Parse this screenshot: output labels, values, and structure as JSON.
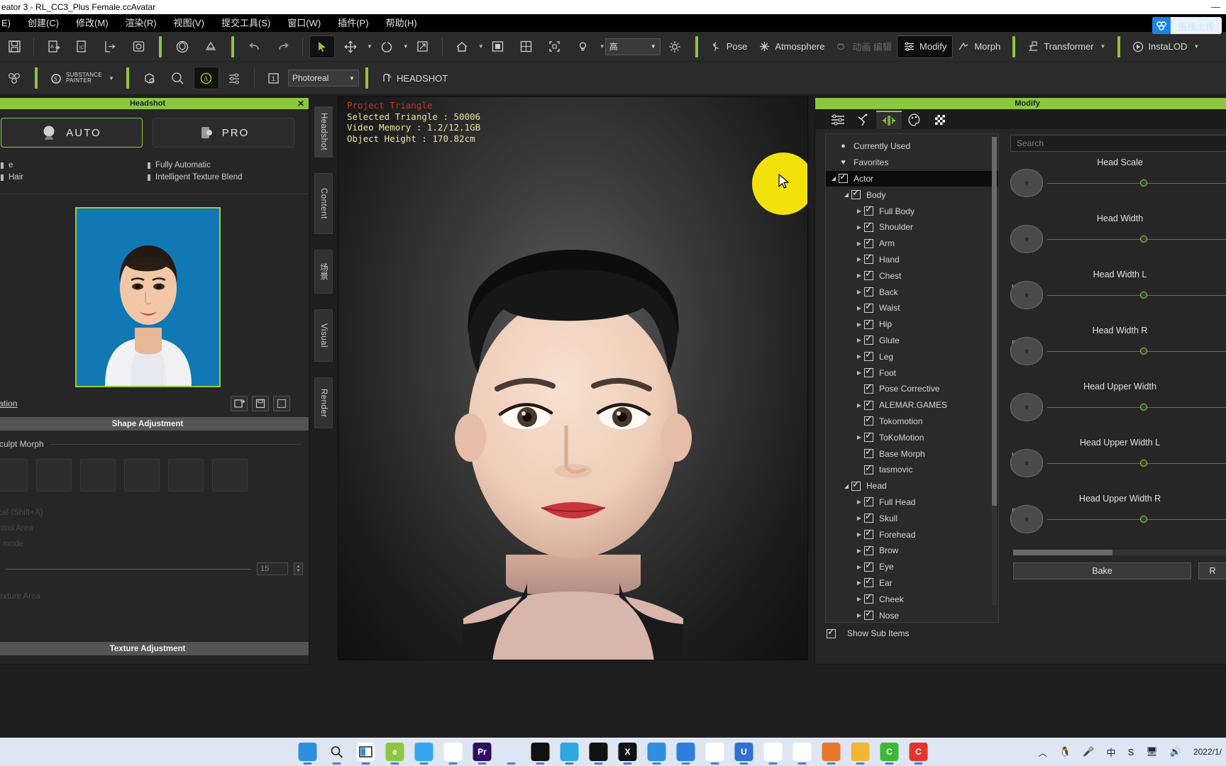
{
  "window": {
    "title": "eator 3 - RL_CC3_Plus Female.ccAvatar",
    "minimize": "—"
  },
  "menu": {
    "items": [
      "E)",
      "创建(C)",
      "修改(M)",
      "渲染(R)",
      "视图(V)",
      "提交工具(S)",
      "窗口(W)",
      "插件(P)",
      "帮助(H)"
    ]
  },
  "toolbar_top": {
    "icons": [
      "save-icon",
      "save-as-icon",
      "import-icon",
      "export-icon",
      "preview-icon",
      "object-icon",
      "terrain-icon"
    ],
    "undo": "undo-icon",
    "redo": "redo-icon",
    "select": "select-arrow-icon",
    "move": "move-icon",
    "rotate": "rotate-icon",
    "scale": "scale-icon",
    "home": "home-icon",
    "camera": "camera-icon",
    "grid": "grid-icon",
    "frame": "frame-icon",
    "light": "light-bulb-icon",
    "quality_value": "高",
    "sun": "sun-icon",
    "pose": "Pose",
    "atmosphere": "Atmosphere",
    "dim_label": "动画 编辑",
    "modify": "Modify",
    "morph": "Morph",
    "transformer": "Transformer",
    "instalod": "InstaLOD"
  },
  "toolbar_second": {
    "substance_line1": "SUBSTANCE",
    "substance_line2": "PAINTER",
    "render_mode": "Photoreal",
    "headshot": "HEADSHOT",
    "icons": [
      "mesh-icon",
      "character-icon",
      "appearance-icon",
      "avatar-icon",
      "lookat-icon",
      "settings-icon",
      "calendar-icon"
    ]
  },
  "upload": {
    "label": "拖拽上传",
    "icon": "cloud-upload-icon"
  },
  "headshot_panel": {
    "title": "Headshot",
    "close": "✕",
    "modes": [
      {
        "label": "AUTO",
        "icon": "auto-head-icon",
        "selected": true
      },
      {
        "label": "PRO",
        "icon": "pro-head-icon",
        "selected": false
      }
    ],
    "features_left": [
      "e",
      "Hair"
    ],
    "features_right": [
      "Fully Automatic",
      "Intelligent Texture Blend"
    ],
    "image_link": "paration",
    "tool_icons": [
      "load-image-icon",
      "save-image-icon",
      "reset-image-icon"
    ],
    "shape_section": "Shape Adjustment",
    "sculpt_group": "Sculpt Morph",
    "dim_lines": [
      "ncal (Shift+A)",
      "ontrol Area",
      "ar mode"
    ],
    "slider_value": "15",
    "texture_section": "Texture Adjustment"
  },
  "viewport": {
    "tabs": [
      "Headshot",
      "Content",
      "场景",
      "Visual",
      "Render"
    ],
    "active_tab": "Headshot",
    "info": {
      "project_triangle": "Project Triangle",
      "selected_triangle_label": "Selected Triangle",
      "selected_triangle_value": "50006",
      "video_memory_label": "Video Memory",
      "video_memory_value": "1.2/12.1GB",
      "object_height_label": "Object Height",
      "object_height_value": "170.82cm"
    }
  },
  "modify_panel": {
    "title": "Modify",
    "tabs": [
      "sliders-icon",
      "pose-icon",
      "morph-edit-icon",
      "material-icon",
      "texture-icon"
    ],
    "active_tab_index": 2,
    "search_placeholder": "Search",
    "tree": [
      {
        "label": "Currently Used",
        "indent": 0,
        "icon": "dot",
        "expander": "none",
        "check": false,
        "selected": false
      },
      {
        "label": "Favorites",
        "indent": 0,
        "icon": "heart",
        "expander": "none",
        "check": false,
        "selected": false
      },
      {
        "label": "Actor",
        "indent": 0,
        "icon": "check",
        "expander": "down",
        "check": true,
        "selected": true
      },
      {
        "label": "Body",
        "indent": 1,
        "icon": "check",
        "expander": "down",
        "check": true,
        "selected": false
      },
      {
        "label": "Full Body",
        "indent": 2,
        "icon": "check",
        "expander": "right",
        "check": true,
        "selected": false
      },
      {
        "label": "Shoulder",
        "indent": 2,
        "icon": "check",
        "expander": "right",
        "check": true,
        "selected": false
      },
      {
        "label": "Arm",
        "indent": 2,
        "icon": "check",
        "expander": "right",
        "check": true,
        "selected": false
      },
      {
        "label": "Hand",
        "indent": 2,
        "icon": "check",
        "expander": "right",
        "check": true,
        "selected": false
      },
      {
        "label": "Chest",
        "indent": 2,
        "icon": "check",
        "expander": "right",
        "check": true,
        "selected": false
      },
      {
        "label": "Back",
        "indent": 2,
        "icon": "check",
        "expander": "right",
        "check": true,
        "selected": false
      },
      {
        "label": "Waist",
        "indent": 2,
        "icon": "check",
        "expander": "right",
        "check": true,
        "selected": false
      },
      {
        "label": "Hip",
        "indent": 2,
        "icon": "check",
        "expander": "right",
        "check": true,
        "selected": false
      },
      {
        "label": "Glute",
        "indent": 2,
        "icon": "check",
        "expander": "right",
        "check": true,
        "selected": false
      },
      {
        "label": "Leg",
        "indent": 2,
        "icon": "check",
        "expander": "right",
        "check": true,
        "selected": false
      },
      {
        "label": "Foot",
        "indent": 2,
        "icon": "check",
        "expander": "right",
        "check": true,
        "selected": false
      },
      {
        "label": "Pose Corrective",
        "indent": 2,
        "icon": "check",
        "expander": "none",
        "check": true,
        "selected": false
      },
      {
        "label": "ALEMAR.GAMES",
        "indent": 2,
        "icon": "check",
        "expander": "right",
        "check": true,
        "selected": false
      },
      {
        "label": "Tokomotion",
        "indent": 2,
        "icon": "check",
        "expander": "none",
        "check": true,
        "selected": false
      },
      {
        "label": "ToKoMotion",
        "indent": 2,
        "icon": "check",
        "expander": "right",
        "check": true,
        "selected": false
      },
      {
        "label": "Base Morph",
        "indent": 2,
        "icon": "check",
        "expander": "none",
        "check": true,
        "selected": false
      },
      {
        "label": "tasmovic",
        "indent": 2,
        "icon": "check",
        "expander": "none",
        "check": true,
        "selected": false
      },
      {
        "label": "Head",
        "indent": 1,
        "icon": "check",
        "expander": "down",
        "check": true,
        "selected": false
      },
      {
        "label": "Full Head",
        "indent": 2,
        "icon": "check",
        "expander": "right",
        "check": true,
        "selected": false
      },
      {
        "label": "Skull",
        "indent": 2,
        "icon": "check",
        "expander": "right",
        "check": true,
        "selected": false
      },
      {
        "label": "Forehead",
        "indent": 2,
        "icon": "check",
        "expander": "right",
        "check": true,
        "selected": false
      },
      {
        "label": "Brow",
        "indent": 2,
        "icon": "check",
        "expander": "right",
        "check": true,
        "selected": false
      },
      {
        "label": "Eye",
        "indent": 2,
        "icon": "check",
        "expander": "right",
        "check": true,
        "selected": false
      },
      {
        "label": "Ear",
        "indent": 2,
        "icon": "check",
        "expander": "right",
        "check": true,
        "selected": false
      },
      {
        "label": "Cheek",
        "indent": 2,
        "icon": "check",
        "expander": "right",
        "check": true,
        "selected": false
      },
      {
        "label": "Nose",
        "indent": 2,
        "icon": "check",
        "expander": "right",
        "check": true,
        "selected": false
      }
    ],
    "show_sub_items": "Show Sub Items",
    "sliders": [
      {
        "name": "Head Scale",
        "side": "",
        "pos": 51
      },
      {
        "name": "Head Width",
        "side": "",
        "pos": 51
      },
      {
        "name": "Head Width L",
        "side": "L",
        "pos": 51
      },
      {
        "name": "Head Width R",
        "side": "R",
        "pos": 51
      },
      {
        "name": "Head Upper Width",
        "side": "",
        "pos": 51
      },
      {
        "name": "Head Upper Width L",
        "side": "L",
        "pos": 51
      },
      {
        "name": "Head Upper Width R",
        "side": "R",
        "pos": 51
      }
    ],
    "buttons": [
      "Bake",
      "R"
    ]
  },
  "taskbar": {
    "apps": [
      {
        "name": "start-windows-icon",
        "color": "#2f8ee0",
        "glyph": ""
      },
      {
        "name": "search-icon",
        "color": "transparent",
        "glyph": ""
      },
      {
        "name": "task-view-icon",
        "color": "#ffffff",
        "glyph": ""
      },
      {
        "name": "edge-legacy-icon",
        "color": "#8dc63f",
        "glyph": "e"
      },
      {
        "name": "bird-app-icon",
        "color": "#34a6f0",
        "glyph": ""
      },
      {
        "name": "telegram-icon",
        "color": "#ffffff",
        "glyph": ""
      },
      {
        "name": "premiere-pro-icon",
        "color": "#2d0e5e",
        "glyph": "Pr"
      },
      {
        "name": "green-globe-icon",
        "color": "#dfe6f3",
        "glyph": ""
      },
      {
        "name": "dark-tool-icon",
        "color": "#111111",
        "glyph": ""
      },
      {
        "name": "blue-chat-icon",
        "color": "#2da7e0",
        "glyph": ""
      },
      {
        "name": "robot-app-icon",
        "color": "#111111",
        "glyph": ""
      },
      {
        "name": "x-app-icon",
        "color": "#111111",
        "glyph": "X"
      },
      {
        "name": "blue-pen-icon",
        "color": "#2f8ee0",
        "glyph": ""
      },
      {
        "name": "design-app-icon",
        "color": "#2f7de0",
        "glyph": ""
      },
      {
        "name": "chrome-icon",
        "color": "#ffffff",
        "glyph": ""
      },
      {
        "name": "u-app-icon",
        "color": "#2f6fd0",
        "glyph": "U"
      },
      {
        "name": "character-creator-icon",
        "color": "#ffffff",
        "glyph": ""
      },
      {
        "name": "cloud-app-icon",
        "color": "#ffffff",
        "glyph": ""
      },
      {
        "name": "photo-app-icon",
        "color": "#e8762c",
        "glyph": ""
      },
      {
        "name": "file-explorer-icon",
        "color": "#f0b832",
        "glyph": ""
      },
      {
        "name": "wechat-green-icon",
        "color": "#3eb735",
        "glyph": "C"
      },
      {
        "name": "red-c-app-icon",
        "color": "#e2342c",
        "glyph": "C"
      }
    ],
    "tray": [
      {
        "name": "show-hidden-icons",
        "glyph": "︿"
      },
      {
        "name": "qq-penguin-icon",
        "glyph": "🐧"
      },
      {
        "name": "microphone-icon",
        "glyph": "🎤"
      },
      {
        "name": "ime-chinese-icon",
        "glyph": "中"
      },
      {
        "name": "sogou-icon",
        "glyph": "S"
      },
      {
        "name": "network-icon",
        "glyph": "🖥"
      },
      {
        "name": "volume-icon",
        "glyph": "🔊"
      }
    ],
    "clock": "2022/1/"
  },
  "colors": {
    "accent": "#8dc63f",
    "panel": "#262626",
    "toolbar": "#2b2b2b",
    "taskbar": "#dfe6f3",
    "upload": "#1b84e7"
  }
}
